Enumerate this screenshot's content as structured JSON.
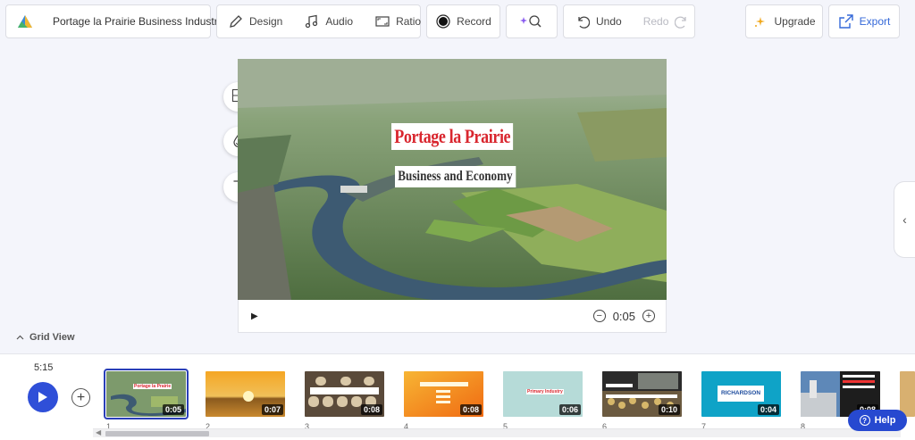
{
  "toolbar": {
    "project_title": "Portage la Prairie Business Industry",
    "design_label": "Design",
    "audio_label": "Audio",
    "ratio_label": "Ratio",
    "record_label": "Record",
    "undo_label": "Undo",
    "redo_label": "Redo",
    "upgrade_label": "Upgrade",
    "export_label": "Export",
    "icons": [
      "logo-icon",
      "pencil-icon",
      "music-note-icon",
      "aspect-ratio-icon",
      "record-icon",
      "sparkle-search-icon",
      "undo-icon",
      "redo-icon",
      "sparkle-icon",
      "export-icon"
    ]
  },
  "slide": {
    "title": "Portage la Prairie",
    "subtitle": "Business and Economy",
    "title_color": "#d9262e"
  },
  "player": {
    "current_duration": "0:05"
  },
  "side_tools": [
    "layout-icon",
    "color-drop-icon",
    "text-icon"
  ],
  "grid_view_label": "Grid View",
  "timeline": {
    "total_time": "5:15",
    "thumbnails": [
      {
        "number": "1",
        "duration": "0:05",
        "selected": true
      },
      {
        "number": "2",
        "duration": "0:07",
        "selected": false
      },
      {
        "number": "3",
        "duration": "0:08",
        "selected": false
      },
      {
        "number": "4",
        "duration": "0:08",
        "selected": false
      },
      {
        "number": "5",
        "duration": "0:06",
        "selected": false
      },
      {
        "number": "6",
        "duration": "0:10",
        "selected": false
      },
      {
        "number": "7",
        "duration": "0:04",
        "selected": false
      },
      {
        "number": "8",
        "duration": "0:08",
        "selected": false
      }
    ],
    "thumb_texts": {
      "t1_title": "Portage la Prairie",
      "t5_title": "Primary Industry",
      "t7_logo": "RICHARDSON"
    }
  },
  "help_label": "Help",
  "colors": {
    "accent": "#2f4fd8",
    "selection": "#2a3fb8",
    "background": "#f4f5fb"
  }
}
